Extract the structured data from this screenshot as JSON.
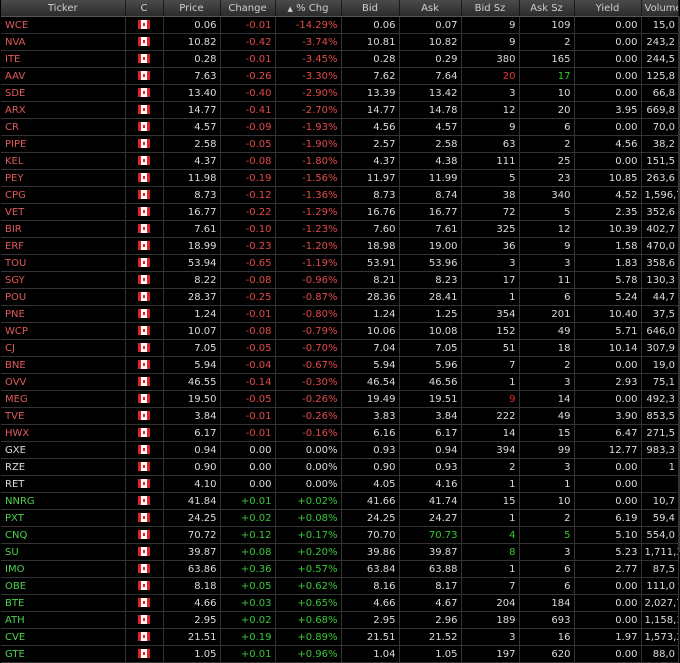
{
  "columns": [
    "Ticker",
    "C",
    "Price",
    "Change",
    "% Chg",
    "Bid",
    "Ask",
    "Bid Sz",
    "Ask Sz",
    "Yield",
    "Volume"
  ],
  "sort_indicator": "▲",
  "rows": [
    {
      "t": "WCE",
      "p": "0.06",
      "c": "-0.01",
      "pc": "-14.29%",
      "b": "0.06",
      "a": "0.07",
      "bs": "9",
      "as": "109",
      "y": "0.00",
      "v": "15,0"
    },
    {
      "t": "NVA",
      "p": "10.82",
      "c": "-0.42",
      "pc": "-3.74%",
      "b": "10.81",
      "a": "10.82",
      "bs": "9",
      "as": "2",
      "y": "0.00",
      "v": "243,2"
    },
    {
      "t": "ITE",
      "p": "0.28",
      "c": "-0.01",
      "pc": "-3.45%",
      "b": "0.28",
      "a": "0.29",
      "bs": "380",
      "as": "165",
      "y": "0.00",
      "v": "244,5"
    },
    {
      "t": "AAV",
      "p": "7.63",
      "c": "-0.26",
      "pc": "-3.30%",
      "b": "7.62",
      "a": "7.64",
      "bs": "20",
      "as": "17",
      "y": "0.00",
      "v": "125,8",
      "bsc": "red",
      "asc": "grn"
    },
    {
      "t": "SDE",
      "p": "13.40",
      "c": "-0.40",
      "pc": "-2.90%",
      "b": "13.39",
      "a": "13.42",
      "bs": "3",
      "as": "10",
      "y": "0.00",
      "v": "66,8"
    },
    {
      "t": "ARX",
      "p": "14.77",
      "c": "-0.41",
      "pc": "-2.70%",
      "b": "14.77",
      "a": "14.78",
      "bs": "12",
      "as": "20",
      "y": "3.95",
      "v": "669,8"
    },
    {
      "t": "CR",
      "p": "4.57",
      "c": "-0.09",
      "pc": "-1.93%",
      "b": "4.56",
      "a": "4.57",
      "bs": "9",
      "as": "6",
      "y": "0.00",
      "v": "70,0"
    },
    {
      "t": "PIPE",
      "p": "2.58",
      "c": "-0.05",
      "pc": "-1.90%",
      "b": "2.57",
      "a": "2.58",
      "bs": "63",
      "as": "2",
      "y": "4.56",
      "v": "38,2"
    },
    {
      "t": "KEL",
      "p": "4.37",
      "c": "-0.08",
      "pc": "-1.80%",
      "b": "4.37",
      "a": "4.38",
      "bs": "111",
      "as": "25",
      "y": "0.00",
      "v": "151,5"
    },
    {
      "t": "PEY",
      "p": "11.98",
      "c": "-0.19",
      "pc": "-1.56%",
      "b": "11.97",
      "a": "11.99",
      "bs": "5",
      "as": "23",
      "y": "10.85",
      "v": "263,6"
    },
    {
      "t": "CPG",
      "p": "8.73",
      "c": "-0.12",
      "pc": "-1.36%",
      "b": "8.73",
      "a": "8.74",
      "bs": "38",
      "as": "340",
      "y": "4.52",
      "v": "1,596,7"
    },
    {
      "t": "VET",
      "p": "16.77",
      "c": "-0.22",
      "pc": "-1.29%",
      "b": "16.76",
      "a": "16.77",
      "bs": "72",
      "as": "5",
      "y": "2.35",
      "v": "352,6"
    },
    {
      "t": "BIR",
      "p": "7.61",
      "c": "-0.10",
      "pc": "-1.23%",
      "b": "7.60",
      "a": "7.61",
      "bs": "325",
      "as": "12",
      "y": "10.39",
      "v": "402,7"
    },
    {
      "t": "ERF",
      "p": "18.99",
      "c": "-0.23",
      "pc": "-1.20%",
      "b": "18.98",
      "a": "19.00",
      "bs": "36",
      "as": "9",
      "y": "1.58",
      "v": "470,0"
    },
    {
      "t": "TOU",
      "p": "53.94",
      "c": "-0.65",
      "pc": "-1.19%",
      "b": "53.91",
      "a": "53.96",
      "bs": "3",
      "as": "3",
      "y": "1.83",
      "v": "358,6"
    },
    {
      "t": "SGY",
      "p": "8.22",
      "c": "-0.08",
      "pc": "-0.96%",
      "b": "8.21",
      "a": "8.23",
      "bs": "17",
      "as": "11",
      "y": "5.78",
      "v": "130,3"
    },
    {
      "t": "POU",
      "p": "28.37",
      "c": "-0.25",
      "pc": "-0.87%",
      "b": "28.36",
      "a": "28.41",
      "bs": "1",
      "as": "6",
      "y": "5.24",
      "v": "44,7"
    },
    {
      "t": "PNE",
      "p": "1.24",
      "c": "-0.01",
      "pc": "-0.80%",
      "b": "1.24",
      "a": "1.25",
      "bs": "354",
      "as": "201",
      "y": "10.40",
      "v": "37,5"
    },
    {
      "t": "WCP",
      "p": "10.07",
      "c": "-0.08",
      "pc": "-0.79%",
      "b": "10.06",
      "a": "10.08",
      "bs": "152",
      "as": "49",
      "y": "5.71",
      "v": "646,0"
    },
    {
      "t": "CJ",
      "p": "7.05",
      "c": "-0.05",
      "pc": "-0.70%",
      "b": "7.04",
      "a": "7.05",
      "bs": "51",
      "as": "18",
      "y": "10.14",
      "v": "307,9"
    },
    {
      "t": "BNE",
      "p": "5.94",
      "c": "-0.04",
      "pc": "-0.67%",
      "b": "5.94",
      "a": "5.96",
      "bs": "7",
      "as": "2",
      "y": "0.00",
      "v": "19,0"
    },
    {
      "t": "OVV",
      "p": "46.55",
      "c": "-0.14",
      "pc": "-0.30%",
      "b": "46.54",
      "a": "46.56",
      "bs": "1",
      "as": "3",
      "y": "2.93",
      "v": "75,1"
    },
    {
      "t": "MEG",
      "p": "19.50",
      "c": "-0.05",
      "pc": "-0.26%",
      "b": "19.49",
      "a": "19.51",
      "bs": "9",
      "as": "14",
      "y": "0.00",
      "v": "492,3",
      "bsc": "red"
    },
    {
      "t": "TVE",
      "p": "3.84",
      "c": "-0.01",
      "pc": "-0.26%",
      "b": "3.83",
      "a": "3.84",
      "bs": "222",
      "as": "49",
      "y": "3.90",
      "v": "853,5"
    },
    {
      "t": "HWX",
      "p": "6.17",
      "c": "-0.01",
      "pc": "-0.16%",
      "b": "6.16",
      "a": "6.17",
      "bs": "14",
      "as": "15",
      "y": "6.47",
      "v": "271,5"
    },
    {
      "t": "GXE",
      "p": "0.94",
      "c": "0.00",
      "pc": "0.00%",
      "b": "0.93",
      "a": "0.94",
      "bs": "394",
      "as": "99",
      "y": "12.77",
      "v": "983,3"
    },
    {
      "t": "RZE",
      "p": "0.90",
      "c": "0.00",
      "pc": "0.00%",
      "b": "0.90",
      "a": "0.93",
      "bs": "2",
      "as": "3",
      "y": "0.00",
      "v": "1"
    },
    {
      "t": "RET",
      "p": "4.10",
      "c": "0.00",
      "pc": "0.00%",
      "b": "4.05",
      "a": "4.16",
      "bs": "1",
      "as": "1",
      "y": "0.00",
      "v": ""
    },
    {
      "t": "NNRG",
      "p": "41.84",
      "c": "+0.01",
      "pc": "+0.02%",
      "b": "41.66",
      "a": "41.74",
      "bs": "15",
      "as": "10",
      "y": "0.00",
      "v": "10,7"
    },
    {
      "t": "PXT",
      "p": "24.25",
      "c": "+0.02",
      "pc": "+0.08%",
      "b": "24.25",
      "a": "24.27",
      "bs": "1",
      "as": "2",
      "y": "6.19",
      "v": "59,4"
    },
    {
      "t": "CNQ",
      "p": "70.72",
      "c": "+0.12",
      "pc": "+0.17%",
      "b": "70.70",
      "a": "70.73",
      "bs": "4",
      "as": "5",
      "y": "5.10",
      "v": "554,0",
      "asc2": "grn",
      "bsc": "grn",
      "asc": "grn"
    },
    {
      "t": "SU",
      "p": "39.87",
      "c": "+0.08",
      "pc": "+0.20%",
      "b": "39.86",
      "a": "39.87",
      "bs": "8",
      "as": "3",
      "y": "5.23",
      "v": "1,711,3",
      "bsc": "grn"
    },
    {
      "t": "IMO",
      "p": "63.86",
      "c": "+0.36",
      "pc": "+0.57%",
      "b": "63.84",
      "a": "63.88",
      "bs": "1",
      "as": "6",
      "y": "2.77",
      "v": "87,5"
    },
    {
      "t": "OBE",
      "p": "8.18",
      "c": "+0.05",
      "pc": "+0.62%",
      "b": "8.16",
      "a": "8.17",
      "bs": "7",
      "as": "6",
      "y": "0.00",
      "v": "111,0"
    },
    {
      "t": "BTE",
      "p": "4.66",
      "c": "+0.03",
      "pc": "+0.65%",
      "b": "4.66",
      "a": "4.67",
      "bs": "204",
      "as": "184",
      "y": "0.00",
      "v": "2,027,7"
    },
    {
      "t": "ATH",
      "p": "2.95",
      "c": "+0.02",
      "pc": "+0.68%",
      "b": "2.95",
      "a": "2.96",
      "bs": "189",
      "as": "693",
      "y": "0.00",
      "v": "1,158,1"
    },
    {
      "t": "CVE",
      "p": "21.51",
      "c": "+0.19",
      "pc": "+0.89%",
      "b": "21.51",
      "a": "21.52",
      "bs": "3",
      "as": "16",
      "y": "1.97",
      "v": "1,573,3"
    },
    {
      "t": "GTE",
      "p": "1.05",
      "c": "+0.01",
      "pc": "+0.96%",
      "b": "1.04",
      "a": "1.05",
      "bs": "197",
      "as": "620",
      "y": "0.00",
      "v": "88,0"
    }
  ]
}
